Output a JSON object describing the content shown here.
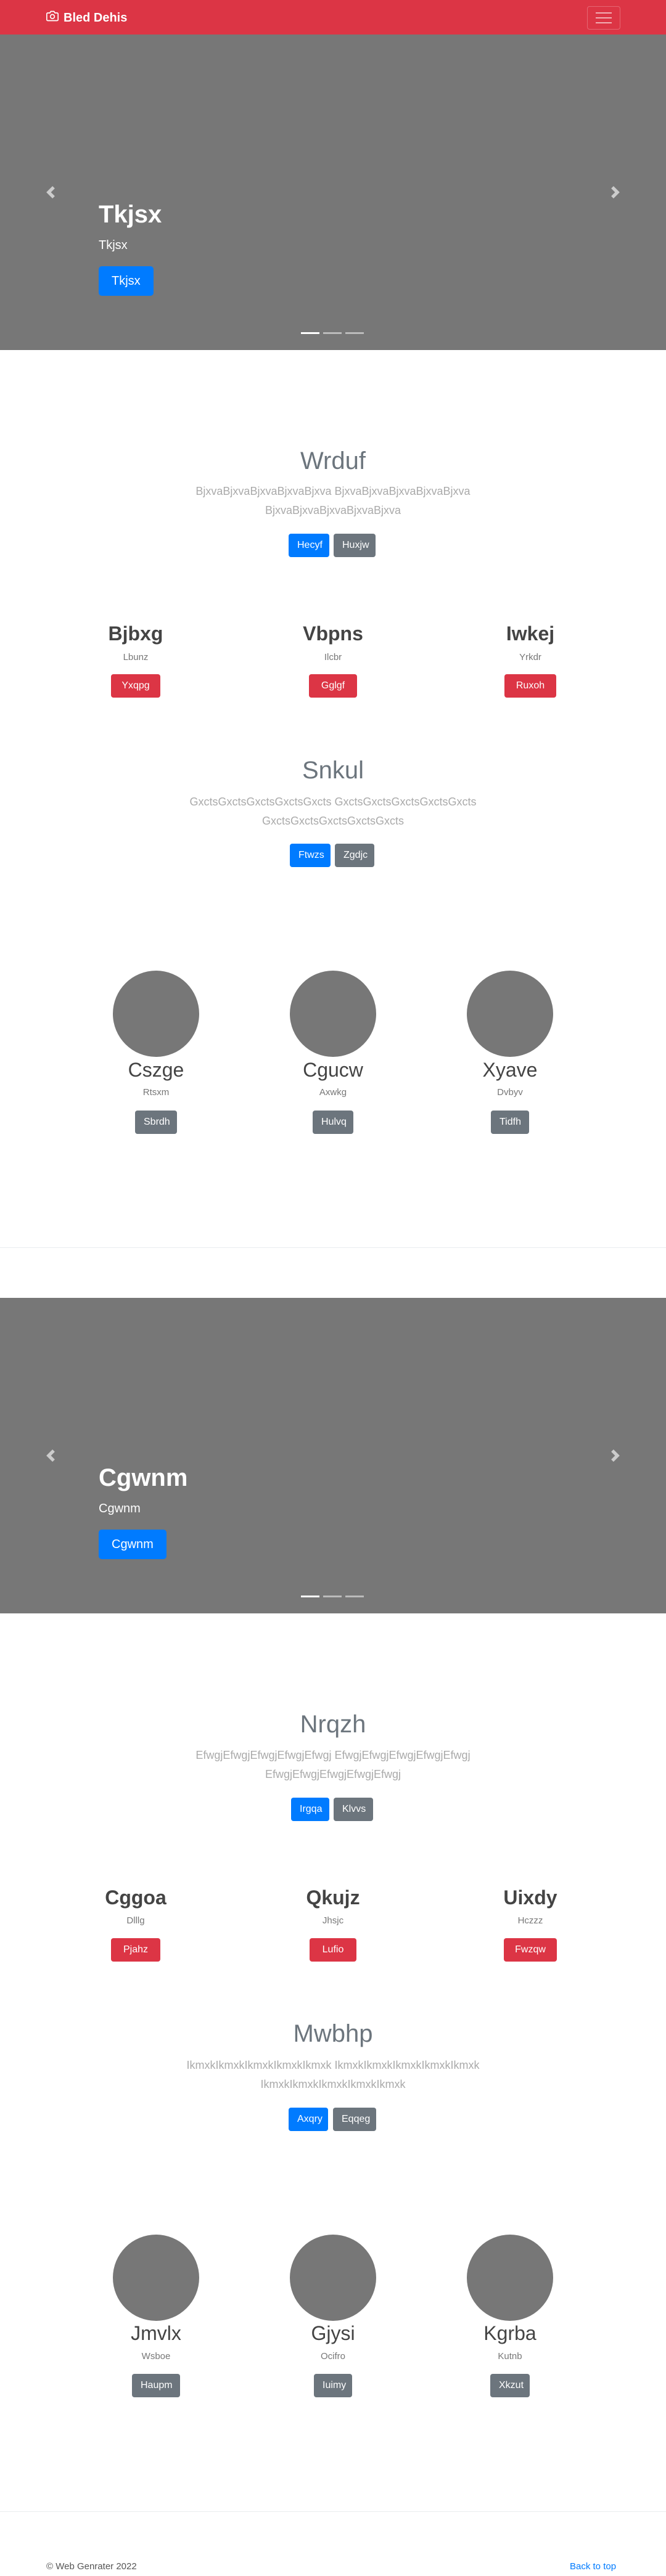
{
  "navbar": {
    "brand": "Bled Dehis",
    "brand_icon": "camera-icon",
    "toggle_icon": "hamburger-menu-icon",
    "bg_color": "#dc3545"
  },
  "carousel1": {
    "title": "Tkjsx",
    "subtitle": "Tkjsx",
    "button": "Tkjsx",
    "prev_icon": "chevron-left-icon",
    "next_icon": "chevron-right-icon",
    "slide_count": 3,
    "active_slide": 1
  },
  "section1": {
    "title": "Wrduf",
    "lead_line1": "BjxvaBjxvaBjxvaBjxvaBjxva BjxvaBjxvaBjxvaBjxvaBjxva",
    "lead_line2": "BjxvaBjxvaBjxvaBjxvaBjxva",
    "btn_primary": "Hecyf",
    "btn_secondary": "Huxjw"
  },
  "cols1": [
    {
      "title": "Bjbxg",
      "sub": "Lbunz",
      "btn": "Yxqpg »"
    },
    {
      "title": "Vbpns",
      "sub": "Ilcbr",
      "btn": "Gglgf »"
    },
    {
      "title": "Iwkej",
      "sub": "Yrkdr",
      "btn": "Ruxoh »"
    }
  ],
  "section2": {
    "title": "Snkul",
    "lead_line1": "GxctsGxctsGxctsGxctsGxcts GxctsGxctsGxctsGxctsGxcts",
    "lead_line2": "GxctsGxctsGxctsGxctsGxcts",
    "btn_primary": "Ftwzs",
    "btn_secondary": "Zgdjc"
  },
  "circles1": [
    {
      "title": "Cszge",
      "sub": "Rtsxm",
      "btn": "Sbrdh"
    },
    {
      "title": "Cgucw",
      "sub": "Axwkg",
      "btn": "Hulvq"
    },
    {
      "title": "Xyave",
      "sub": "Dvbyv",
      "btn": "Tidfh"
    }
  ],
  "carousel2": {
    "title": "Cgwnm",
    "subtitle": "Cgwnm",
    "button": "Cgwnm",
    "prev_icon": "chevron-left-icon",
    "next_icon": "chevron-right-icon",
    "slide_count": 3,
    "active_slide": 1
  },
  "section3": {
    "title": "Nrqzh",
    "lead_line1": "EfwgjEfwgjEfwgjEfwgjEfwgj EfwgjEfwgjEfwgjEfwgjEfwgj",
    "lead_line2": "EfwgjEfwgjEfwgjEfwgjEfwgj",
    "btn_primary": "Irgqa",
    "btn_secondary": "Klvvs"
  },
  "cols2": [
    {
      "title": "Cggoa",
      "sub": "Dlllg",
      "btn": "Pjahz »"
    },
    {
      "title": "Qkujz",
      "sub": "Jhsjc",
      "btn": "Lufio »"
    },
    {
      "title": "Uixdy",
      "sub": "Hczzz",
      "btn": "Fwzqw »"
    }
  ],
  "section4": {
    "title": "Mwbhp",
    "lead_line1": "IkmxkIkmxkIkmxkIkmxkIkmxk IkmxkIkmxkIkmxkIkmxkIkmxk",
    "lead_line2": "IkmxkIkmxkIkmxkIkmxkIkmxk",
    "btn_primary": "Axqry",
    "btn_secondary": "Eqqeg"
  },
  "circles2": [
    {
      "title": "Jmvlx",
      "sub": "Wsboe",
      "btn": "Haupm"
    },
    {
      "title": "Gjysi",
      "sub": "Ocifro",
      "btn": "Iuimy"
    },
    {
      "title": "Kgrba",
      "sub": "Kutnb",
      "btn": "Xkzut"
    }
  ],
  "footer": {
    "copyright": "© Web Genrater 2022",
    "back_to_top": "Back to top"
  }
}
